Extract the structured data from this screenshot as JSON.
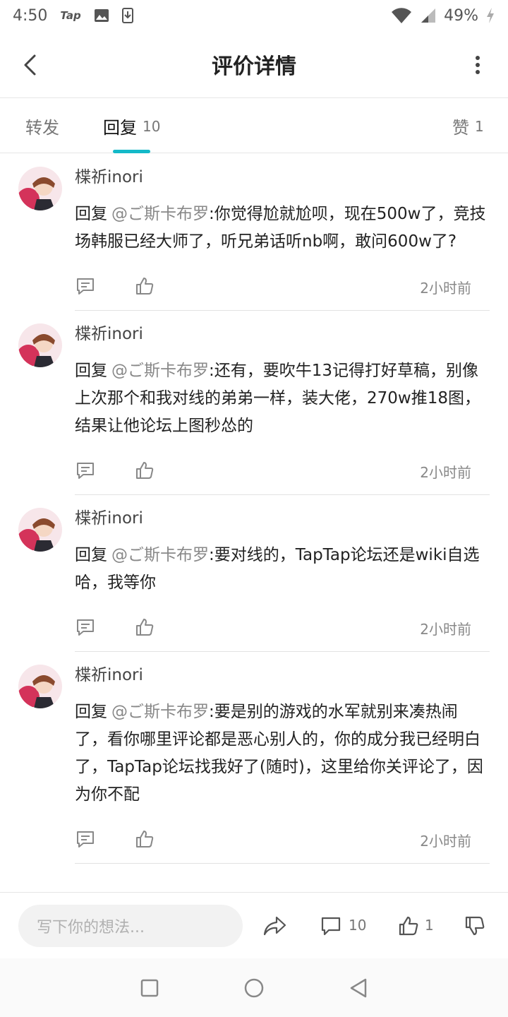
{
  "status": {
    "time": "4:50",
    "app_badge": "Tap",
    "battery": "49%"
  },
  "header": {
    "title": "评价详情"
  },
  "tabs": [
    {
      "label": "转发",
      "count": ""
    },
    {
      "label": "回复",
      "count": "10"
    },
    {
      "label": "赞",
      "count": "1"
    }
  ],
  "replies": [
    {
      "user": "楪祈inori",
      "lead": "回复",
      "mention": "@ご斯卡布罗",
      "text": ":你觉得尬就尬呗，现在500w了，竞技场韩服已经大师了，听兄弟话听nb啊，敢问600w了?",
      "time": "2小时前"
    },
    {
      "user": "楪祈inori",
      "lead": "回复",
      "mention": "@ご斯卡布罗",
      "text": ":还有，要吹牛13记得打好草稿，别像上次那个和我对线的弟弟一样，装大佬，270w推18图，结果让他论坛上图秒怂的",
      "time": "2小时前"
    },
    {
      "user": "楪祈inori",
      "lead": "回复",
      "mention": "@ご斯卡布罗",
      "text": ":要对线的，TapTap论坛还是wiki自选哈，我等你",
      "time": "2小时前"
    },
    {
      "user": "楪祈inori",
      "lead": "回复",
      "mention": "@ご斯卡布罗",
      "text": ":要是别的游戏的水军就别来凑热闹了，看你哪里评论都是恶心别人的，你的成分我已经明白了，TapTap论坛找我好了(随时)，这里给你关评论了，因为你不配",
      "time": "2小时前"
    }
  ],
  "bottom": {
    "placeholder": "写下你的想法...",
    "comment_count": "10",
    "like_count": "1"
  },
  "colors": {
    "accent": "#14b9c8"
  }
}
